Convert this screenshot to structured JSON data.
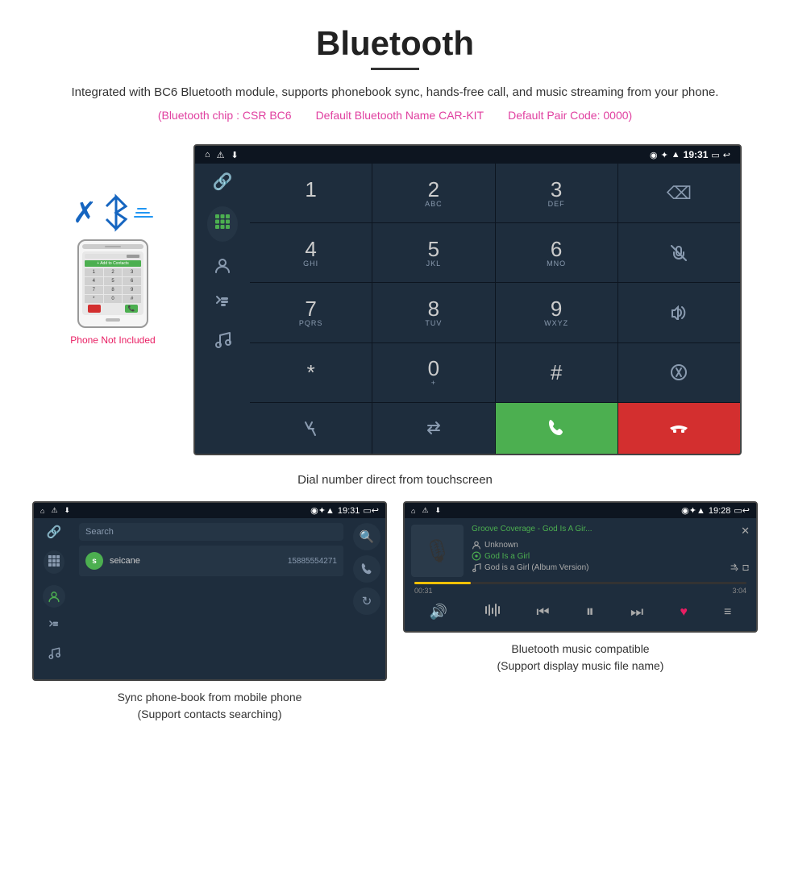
{
  "header": {
    "title": "Bluetooth",
    "subtitle": "Integrated with BC6 Bluetooth module, supports phonebook sync, hands-free call, and music streaming from your phone.",
    "specs": {
      "chip": "(Bluetooth chip : CSR BC6",
      "name": "Default Bluetooth Name CAR-KIT",
      "code": "Default Pair Code: 0000)"
    }
  },
  "phone_label": "Phone Not Included",
  "dialer_caption": "Dial number direct from touchscreen",
  "status_bar": {
    "left_icons": [
      "⌂",
      "⚠",
      "↓"
    ],
    "right_icons": [
      "◉",
      "✦",
      "▲"
    ],
    "time": "19:31",
    "battery": "▭",
    "back": "↩"
  },
  "dialer_keys": [
    {
      "num": "1",
      "letters": ""
    },
    {
      "num": "2",
      "letters": "ABC"
    },
    {
      "num": "3",
      "letters": "DEF"
    },
    {
      "num": "⌫",
      "letters": ""
    },
    {
      "num": "4",
      "letters": "GHI"
    },
    {
      "num": "5",
      "letters": "JKL"
    },
    {
      "num": "6",
      "letters": "MNO"
    },
    {
      "num": "🎤",
      "letters": ""
    },
    {
      "num": "7",
      "letters": "PQRS"
    },
    {
      "num": "8",
      "letters": "TUV"
    },
    {
      "num": "9",
      "letters": "WXYZ"
    },
    {
      "num": "🔊",
      "letters": ""
    },
    {
      "num": "*",
      "letters": ""
    },
    {
      "num": "0",
      "letters": "+"
    },
    {
      "num": "#",
      "letters": ""
    },
    {
      "num": "⇅",
      "letters": ""
    },
    {
      "num": "↑",
      "letters": ""
    },
    {
      "num": "⇄",
      "letters": ""
    },
    {
      "num": "CALL",
      "letters": ""
    },
    {
      "num": "END",
      "letters": ""
    }
  ],
  "sidebar_icons": [
    "🔗",
    "⌨",
    "👤",
    "📞",
    "🎵"
  ],
  "phonebook": {
    "caption_line1": "Sync phone-book from mobile phone",
    "caption_line2": "(Support contacts searching)",
    "status_time": "19:31",
    "search_placeholder": "Search",
    "contact": {
      "initial": "s",
      "name": "seicane",
      "phone": "15885554271"
    }
  },
  "music": {
    "caption_line1": "Bluetooth music compatible",
    "caption_line2": "(Support display music file name)",
    "status_time": "19:28",
    "track_title": "Groove Coverage - God Is A Gir...",
    "artist": "Unknown",
    "album": "God Is a Girl",
    "song": "God is a Girl (Album Version)",
    "time_current": "00:31",
    "time_total": "3:04",
    "progress_percent": 17
  }
}
